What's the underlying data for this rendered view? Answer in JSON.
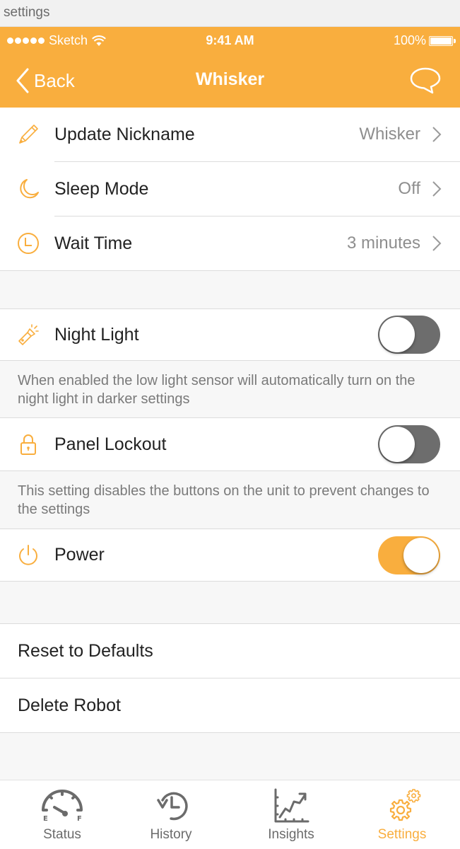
{
  "window": {
    "title": "settings"
  },
  "status_bar": {
    "carrier": "Sketch",
    "time": "9:41 AM",
    "battery": "100%",
    "signal_bars": 5
  },
  "nav": {
    "back_label": "Back",
    "title": "Whisker",
    "chat_icon": "chat-bubble-icon"
  },
  "settings_group_1": [
    {
      "icon": "pencil-icon",
      "label": "Update Nickname",
      "value": "Whisker"
    },
    {
      "icon": "moon-icon",
      "label": "Sleep Mode",
      "value": "Off"
    },
    {
      "icon": "clock-icon",
      "label": "Wait Time",
      "value": "3 minutes"
    }
  ],
  "toggles": [
    {
      "icon": "flashlight-icon",
      "label": "Night Light",
      "on": false,
      "description": "When enabled the low light sensor will automatically turn on the night light in darker settings"
    },
    {
      "icon": "lock-icon",
      "label": "Panel Lockout",
      "on": false,
      "description": "This setting disables the buttons on the unit to prevent changes to the settings"
    },
    {
      "icon": "power-icon",
      "label": "Power",
      "on": true
    }
  ],
  "actions": [
    {
      "label": "Reset to Defaults"
    },
    {
      "label": "Delete Robot"
    }
  ],
  "tabbar": [
    {
      "icon": "gauge-icon",
      "label": "Status",
      "active": false
    },
    {
      "icon": "history-icon",
      "label": "History",
      "active": false
    },
    {
      "icon": "chart-icon",
      "label": "Insights",
      "active": false
    },
    {
      "icon": "gears-icon",
      "label": "Settings",
      "active": true
    }
  ],
  "colors": {
    "accent": "#f9ae3e",
    "toggle_off": "#6d6d6d",
    "text": "#222222",
    "secondary_text": "#8e8e8e",
    "tab_inactive": "#6b6b6b",
    "background": "#f7f7f7"
  }
}
